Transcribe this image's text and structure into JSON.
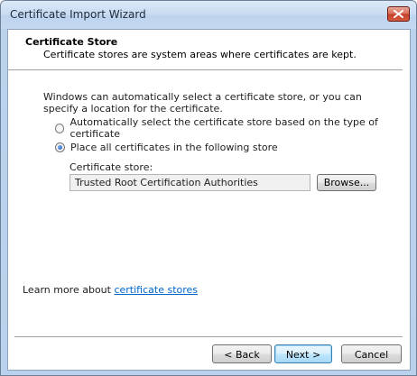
{
  "window": {
    "title": "Certificate Import Wizard",
    "close_icon": "close-x-icon"
  },
  "header": {
    "title": "Certificate Store",
    "subtitle": "Certificate stores are system areas where certificates are kept."
  },
  "main": {
    "description": "Windows can automatically select a certificate store, or you can specify a location for the certificate.",
    "options": [
      {
        "label": "Automatically select the certificate store based on the type of certificate",
        "selected": false
      },
      {
        "label": "Place all certificates in the following store",
        "selected": true
      }
    ],
    "store_label": "Certificate store:",
    "store_value": "Trusted Root Certification Authorities",
    "browse_label": "Browse..."
  },
  "footer": {
    "learn_prefix": "Learn more about ",
    "learn_link": "certificate stores",
    "back_label": "< Back",
    "next_label": "Next >",
    "cancel_label": "Cancel"
  },
  "colors": {
    "link": "#0066cc",
    "close_button": "#c4402b",
    "frame": "#bcd3ee"
  }
}
